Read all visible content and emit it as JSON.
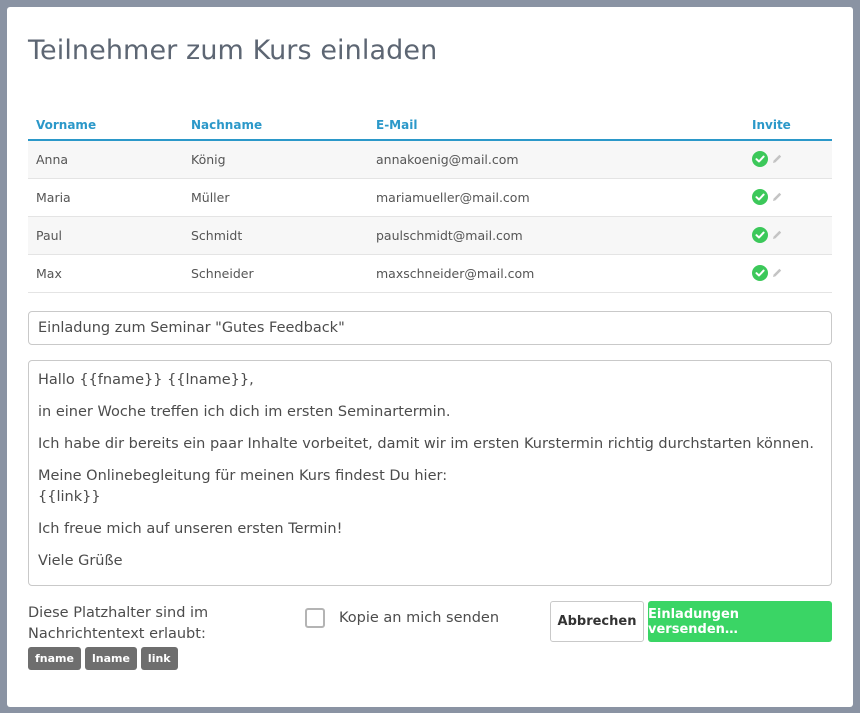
{
  "dialog": {
    "title": "Teilnehmer zum Kurs einladen"
  },
  "table": {
    "headers": {
      "firstname": "Vorname",
      "lastname": "Nachname",
      "email": "E-Mail",
      "invite": "Invite"
    },
    "rows": [
      {
        "firstname": "Anna",
        "lastname": "König",
        "email": "annakoenig@mail.com",
        "invited": true
      },
      {
        "firstname": "Maria",
        "lastname": "Müller",
        "email": "mariamueller@mail.com",
        "invited": true
      },
      {
        "firstname": "Paul",
        "lastname": "Schmidt",
        "email": "paulschmidt@mail.com",
        "invited": true
      },
      {
        "firstname": "Max",
        "lastname": "Schneider",
        "email": "maxschneider@mail.com",
        "invited": true
      }
    ]
  },
  "subject": {
    "value": "Einladung zum Seminar \"Gutes Feedback\""
  },
  "message": {
    "lines": [
      "Hallo {{fname}} {{lname}},",
      "in einer Woche treffen ich dich im ersten Seminartermin.",
      "Ich habe dir bereits ein paar Inhalte vorbeitet, damit wir im ersten Kurstermin richtig durchstarten können.",
      "Meine Onlinebegleitung für meinen Kurs findest Du hier:",
      "{{link}}",
      "Ich freue mich auf unseren ersten Termin!",
      "Viele Grüße"
    ]
  },
  "placeholders": {
    "hint": "Diese Platzhalter sind im Nachrichtentext erlaubt:",
    "tags": [
      "fname",
      "lname",
      "link"
    ]
  },
  "copy": {
    "label": "Kopie an mich senden",
    "checked": false
  },
  "buttons": {
    "cancel": "Abbrechen",
    "send": "Einladungen versenden…"
  },
  "colors": {
    "accent": "#2b98c9",
    "success": "#3cc85a",
    "send_button": "#3ad565",
    "tag": "#6e6e6e"
  },
  "icons": {
    "invite_status": "check-circle-icon",
    "edit": "pencil-icon"
  }
}
